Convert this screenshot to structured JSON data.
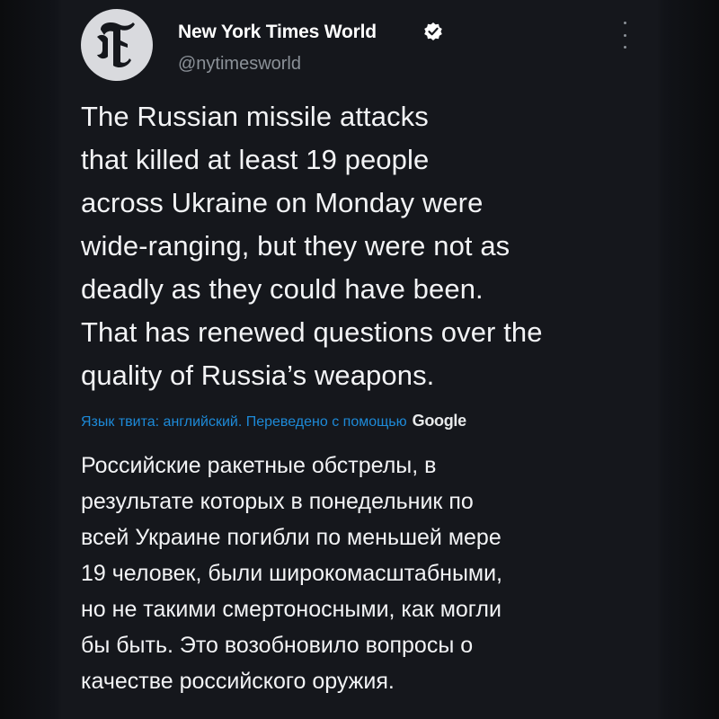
{
  "author": {
    "display_name": "New York Times World",
    "handle": "@nytimesworld",
    "avatar_icon": "nyt-logo-icon",
    "verified_icon": "verified-badge-icon"
  },
  "more_icon": "more-vertical-icon",
  "tweet": {
    "lines": [
      "The Russian missile attacks",
      "that killed at least 19 people",
      "across Ukraine on Monday were",
      "wide-ranging, but they were not as",
      "deadly as they could have been.",
      "That has renewed questions over the",
      "quality of Russia’s weapons."
    ]
  },
  "translation": {
    "note": "Язык твита: английский. Переведено с помощью",
    "provider": "Google",
    "lines": [
      "Российские ракетные обстрелы, в",
      "результате которых в понедельник по",
      "всей Украине погибли по меньшей мере",
      "19 человек, были широкомасштабными,",
      "но не такими смертоносными, как могли",
      "бы быть. Это возобновило вопросы о",
      "качестве российского оружия."
    ]
  },
  "colors": {
    "background": "#15171c",
    "text": "#f2f3f5",
    "secondary": "#8b9198",
    "link": "#1d8ad8",
    "verified": "#ffffff"
  }
}
